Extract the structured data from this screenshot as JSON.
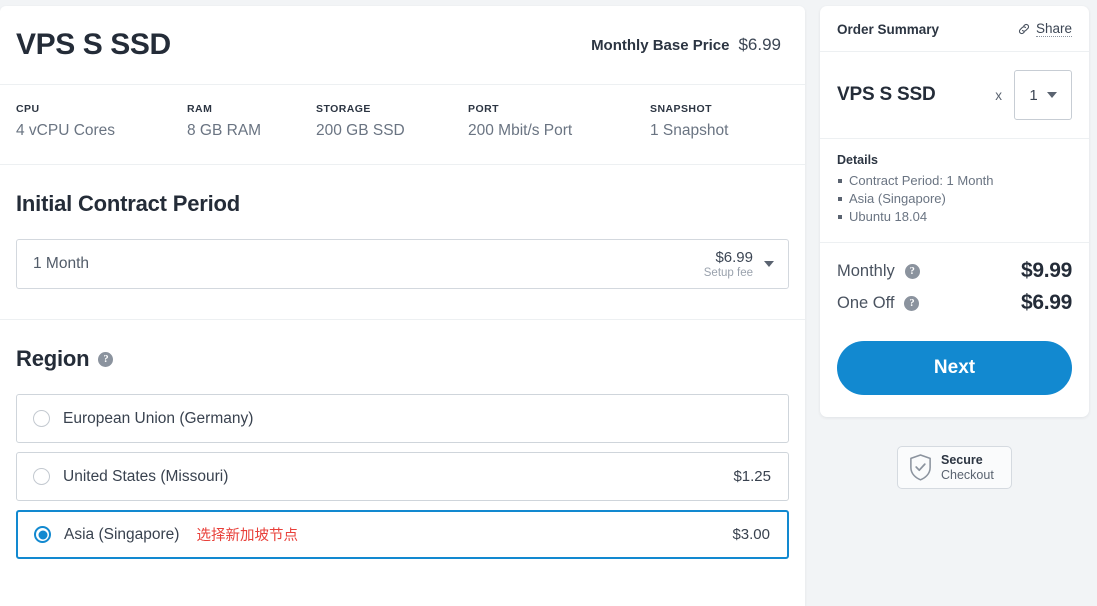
{
  "product": {
    "title": "VPS S SSD",
    "price_label": "Monthly Base Price",
    "price_value": "$6.99"
  },
  "specs": [
    {
      "key": "CPU",
      "value": "4 vCPU Cores"
    },
    {
      "key": "RAM",
      "value": "8 GB RAM"
    },
    {
      "key": "STORAGE",
      "value": "200 GB SSD"
    },
    {
      "key": "PORT",
      "value": "200 Mbit/s Port"
    },
    {
      "key": "SNAPSHOT",
      "value": "1 Snapshot"
    }
  ],
  "contract": {
    "section_title": "Initial Contract Period",
    "selected": "1 Month",
    "price": "$6.99",
    "price_sub": "Setup fee",
    "caret_icon": "chevron-down-icon"
  },
  "region": {
    "section_title": "Region",
    "help_icon": "question-mark-icon",
    "options": [
      {
        "label": "European Union (Germany)",
        "price": "",
        "note": "",
        "selected": false
      },
      {
        "label": "United States (Missouri)",
        "price": "$1.25",
        "note": "",
        "selected": false
      },
      {
        "label": "Asia (Singapore)",
        "price": "$3.00",
        "note": "选择新加坡节点",
        "selected": true
      }
    ]
  },
  "summary": {
    "title": "Order Summary",
    "share_label": "Share",
    "share_icon": "link-icon",
    "item_name": "VPS S SSD",
    "multiply_symbol": "x",
    "quantity": "1",
    "qty_caret_icon": "chevron-down-icon",
    "details_title": "Details",
    "details": [
      "Contract Period: 1 Month",
      "Asia (Singapore)",
      "Ubuntu 18.04"
    ],
    "totals": [
      {
        "label": "Monthly",
        "value": "$9.99",
        "help_icon": "question-mark-icon"
      },
      {
        "label": "One Off",
        "value": "$6.99",
        "help_icon": "question-mark-icon"
      }
    ],
    "next_label": "Next"
  },
  "secure": {
    "icon": "shield-check-icon",
    "line1": "Secure",
    "line2": "Checkout"
  },
  "colors": {
    "accent": "#1289d0",
    "note_red": "#e8403a",
    "page_bg": "#f2f4f6",
    "text_dark": "#242c38",
    "text_muted": "#6a7482"
  }
}
